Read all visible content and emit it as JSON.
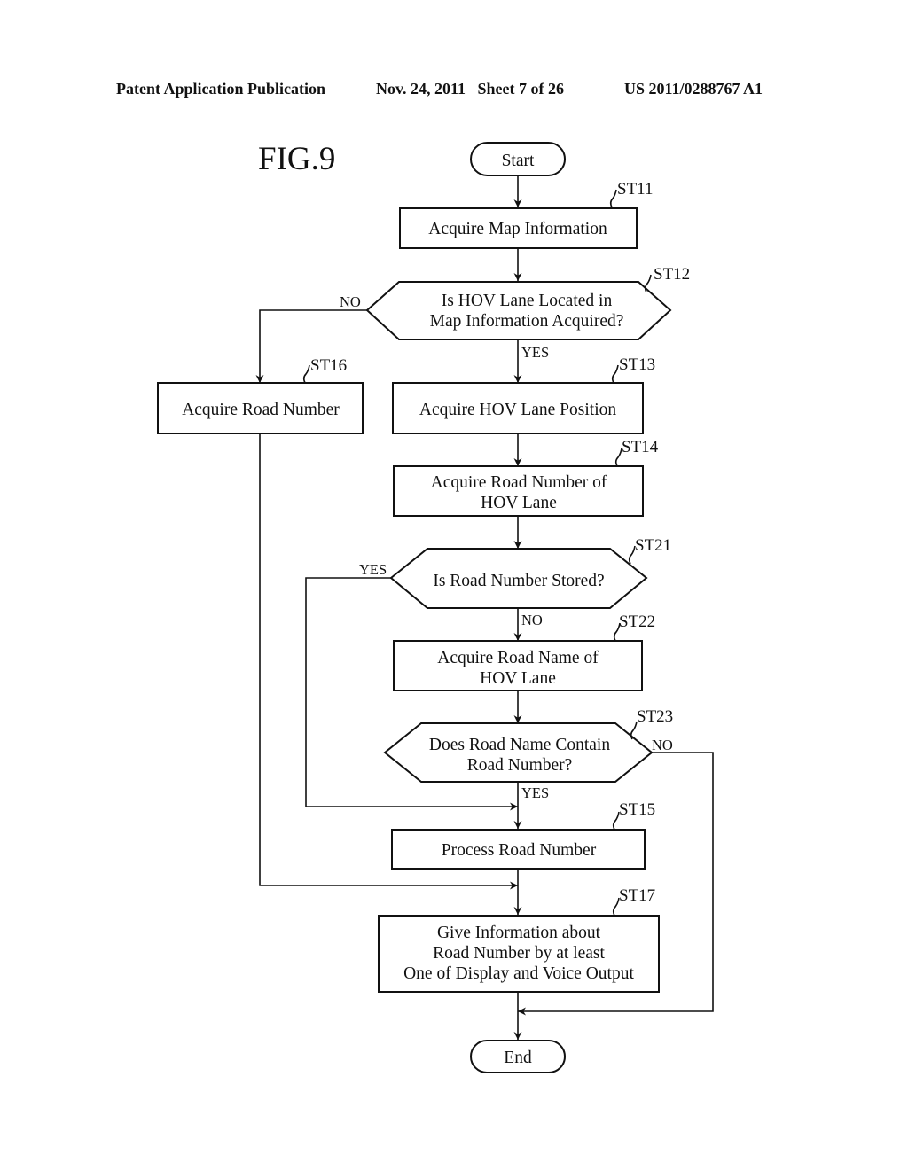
{
  "header": {
    "publication": "Patent Application Publication",
    "date_sheet": "Nov. 24, 2011   Sheet 7 of 26",
    "number": "US 2011/0288767 A1"
  },
  "figure": {
    "label": "FIG.9"
  },
  "nodes": {
    "start": {
      "type": "terminal",
      "lines": [
        "Start"
      ]
    },
    "st11": {
      "id": "ST11",
      "type": "process",
      "lines": [
        "Acquire Map Information"
      ]
    },
    "st12": {
      "id": "ST12",
      "type": "decision",
      "lines": [
        "Is HOV Lane Located in",
        "Map Information Acquired?"
      ]
    },
    "st13": {
      "id": "ST13",
      "type": "process",
      "lines": [
        "Acquire HOV Lane Position"
      ]
    },
    "st14": {
      "id": "ST14",
      "type": "process",
      "lines": [
        "Acquire Road Number of",
        "HOV Lane"
      ]
    },
    "st16": {
      "id": "ST16",
      "type": "process",
      "lines": [
        "Acquire Road Number"
      ]
    },
    "st21": {
      "id": "ST21",
      "type": "decision",
      "lines": [
        "Is Road Number Stored?"
      ]
    },
    "st22": {
      "id": "ST22",
      "type": "process",
      "lines": [
        "Acquire Road Name of",
        "HOV Lane"
      ]
    },
    "st23": {
      "id": "ST23",
      "type": "decision",
      "lines": [
        "Does Road Name Contain",
        "Road Number?"
      ]
    },
    "st15": {
      "id": "ST15",
      "type": "process",
      "lines": [
        "Process Road Number"
      ]
    },
    "st17": {
      "id": "ST17",
      "type": "process",
      "lines": [
        "Give Information about",
        "Road Number by at least",
        "One of Display and Voice Output"
      ]
    },
    "end": {
      "type": "terminal",
      "lines": [
        "End"
      ]
    }
  },
  "branch_labels": {
    "st12_no": "NO",
    "st12_yes": "YES",
    "st21_yes": "YES",
    "st21_no": "NO",
    "st23_no": "NO",
    "st23_yes": "YES"
  },
  "edges": [
    {
      "from": "start",
      "to": "st11"
    },
    {
      "from": "st11",
      "to": "st12"
    },
    {
      "from": "st12",
      "to": "st13",
      "label": "YES"
    },
    {
      "from": "st12",
      "to": "st16",
      "label": "NO"
    },
    {
      "from": "st13",
      "to": "st14"
    },
    {
      "from": "st14",
      "to": "st21"
    },
    {
      "from": "st21",
      "to": "st22",
      "label": "NO"
    },
    {
      "from": "st21",
      "to": "st15",
      "label": "YES"
    },
    {
      "from": "st22",
      "to": "st23"
    },
    {
      "from": "st23",
      "to": "st15",
      "label": "YES"
    },
    {
      "from": "st23",
      "to": "end",
      "label": "NO"
    },
    {
      "from": "st15",
      "to": "st17"
    },
    {
      "from": "st16",
      "to": "st17"
    },
    {
      "from": "st17",
      "to": "end"
    }
  ]
}
